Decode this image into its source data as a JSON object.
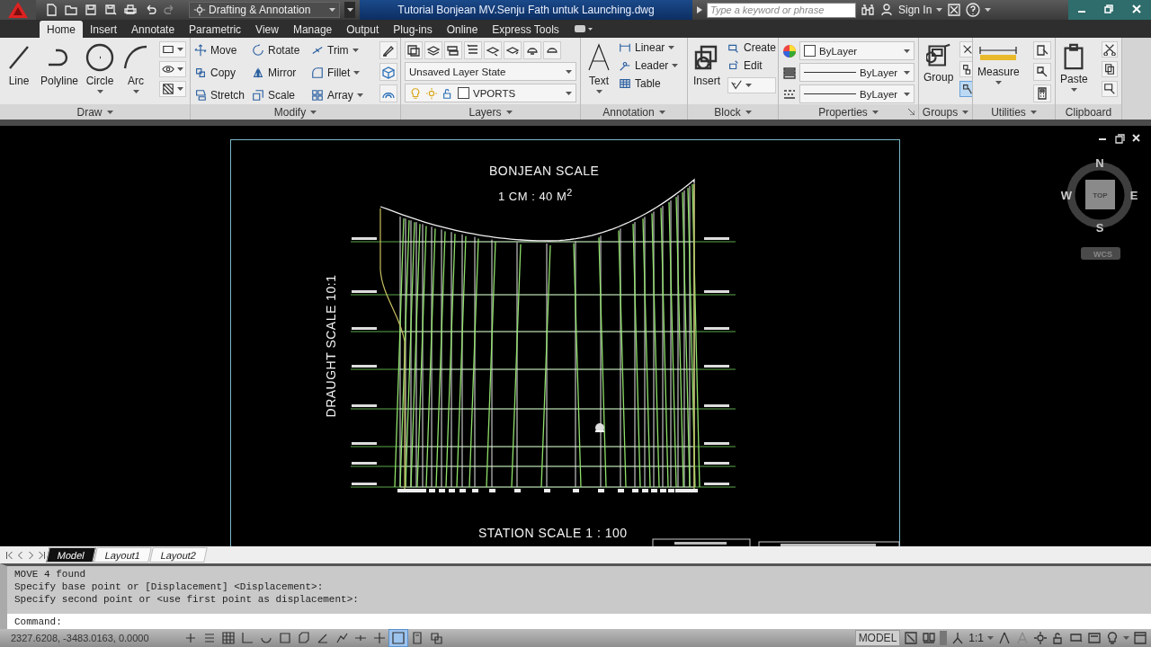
{
  "title_bar": {
    "workspace": "Drafting & Annotation",
    "title": "Tutorial Bonjean MV.Senju Fath untuk Launching.dwg",
    "search": {
      "placeholder": "Type a keyword or phrase"
    },
    "sign_in": "Sign In"
  },
  "ribbon_tabs": [
    {
      "label": "Home",
      "selected": true
    },
    {
      "label": "Insert",
      "selected": false
    },
    {
      "label": "Annotate",
      "selected": false
    },
    {
      "label": "Parametric",
      "selected": false
    },
    {
      "label": "View",
      "selected": false
    },
    {
      "label": "Manage",
      "selected": false
    },
    {
      "label": "Output",
      "selected": false
    },
    {
      "label": "Plug-ins",
      "selected": false
    },
    {
      "label": "Online",
      "selected": false
    },
    {
      "label": "Express Tools",
      "selected": false
    }
  ],
  "panels": {
    "draw": {
      "label": "Draw",
      "tools": [
        "Line",
        "Polyline",
        "Circle",
        "Arc"
      ]
    },
    "modify": {
      "label": "Modify",
      "tools": [
        "Move",
        "Rotate",
        "Trim",
        "Copy",
        "Mirror",
        "Fillet",
        "Stretch",
        "Scale",
        "Array"
      ]
    },
    "layers": {
      "label": "Layers",
      "layer_state": "Unsaved Layer State",
      "current_layer": "VPORTS"
    },
    "annotation": {
      "label": "Annotation",
      "text_tool": "Text",
      "tools": [
        "Linear",
        "Leader",
        "Table"
      ]
    },
    "block": {
      "label": "Block",
      "insert": "Insert",
      "tools": [
        "Create",
        "Edit"
      ]
    },
    "properties": {
      "label": "Properties",
      "object_color": "ByLayer",
      "object_linetype": "ByLayer",
      "object_lineweight": "ByLayer"
    },
    "groups": {
      "label": "Groups",
      "tool": "Group"
    },
    "utilities": {
      "label": "Utilities",
      "tool": "Measure"
    },
    "clipboard": {
      "label": "Clipboard",
      "tool": "Paste"
    }
  },
  "drawing": {
    "title": "BONJEAN SCALE",
    "area_scale": "1 CM : 40 M$^{2}$",
    "draught_label": "DRAUGHT SCALE 10:1",
    "station_label": "STATION SCALE 1 : 100"
  },
  "viewcube": {
    "north": "N",
    "south": "S",
    "east": "E",
    "west": "W",
    "face": "TOP",
    "ucs": "WCS"
  },
  "layout_tabs": [
    {
      "label": "Model",
      "selected": true
    },
    {
      "label": "Layout1",
      "selected": false
    },
    {
      "label": "Layout2",
      "selected": false
    }
  ],
  "command_history": [
    "MOVE 4 found",
    "Specify base point or [Displacement] <Displacement>:",
    "Specify second point or <use first point as displacement>:"
  ],
  "command_prompt": "Command:",
  "status_bar": {
    "coordinates": "2327.6208, -3483.0163, 0.0000",
    "space": "MODEL",
    "annotation_scale": "1:1",
    "toggles": [
      {
        "on": false
      },
      {
        "on": false
      },
      {
        "on": false
      },
      {
        "on": false
      },
      {
        "on": false
      },
      {
        "on": false
      },
      {
        "on": false
      },
      {
        "on": false
      },
      {
        "on": false
      },
      {
        "on": false
      },
      {
        "on": false
      },
      {
        "on": true
      },
      {
        "on": false
      },
      {
        "on": false
      }
    ]
  }
}
